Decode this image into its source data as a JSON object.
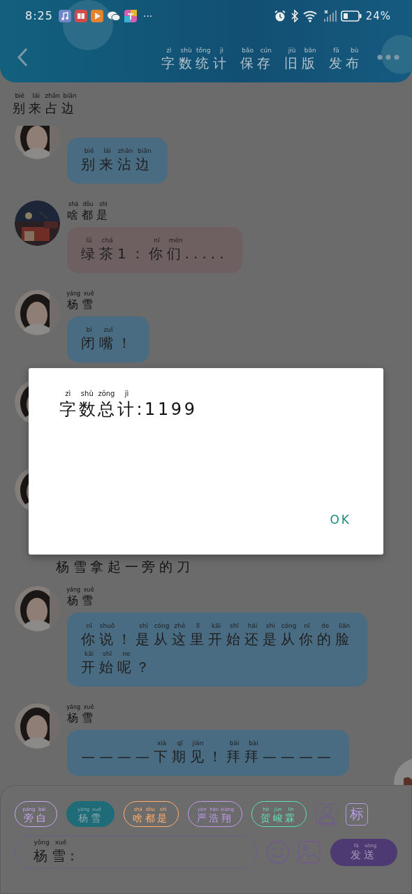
{
  "status_bar": {
    "time": "8:25",
    "more": "···",
    "battery": "24%"
  },
  "header": {
    "actions": [
      {
        "pinyin": "zì shù tǒng jì",
        "text": "字数统计"
      },
      {
        "pinyin": "bǎo cún",
        "text": "保存"
      },
      {
        "pinyin": "jiù bǎn",
        "text": "旧版"
      },
      {
        "pinyin": "fā bù",
        "text": "发布"
      }
    ]
  },
  "title": {
    "pinyin": "bié lái zhān biān",
    "text": "别来占边"
  },
  "messages": [
    {
      "kind": "message",
      "color": "#4a6c82",
      "bubble": {
        "pinyin": "bié lái zhān biān",
        "text": "别来沾边"
      }
    },
    {
      "kind": "message",
      "color": "#6e6060",
      "sender": {
        "pinyin": "shá dōu shì",
        "text": "啥都是"
      },
      "bubble": {
        "pinyin": "lǜ chá nǐ mén",
        "text": "绿茶1：你们....."
      }
    },
    {
      "kind": "message",
      "color": "#4a6c82",
      "sender": {
        "pinyin": "yáng xuě",
        "text": "杨雪"
      },
      "bubble": {
        "pinyin": "bì zuǐ",
        "text": "闭嘴！"
      }
    },
    {
      "kind": "covered"
    },
    {
      "kind": "covered"
    },
    {
      "kind": "narration",
      "text": "杨雪拿起一旁的刀"
    },
    {
      "kind": "message",
      "color": "#4a6c82",
      "sender": {
        "pinyin": "yáng xuě",
        "text": "杨雪"
      },
      "bubble": {
        "pinyin": "nǐ shuō shì cóng zhè lǐ kāi shǐ hái shì cóng nǐ de liǎn",
        "text": "你说！是从这里开始还是从你的脸"
      },
      "bubble_line_2": {
        "pinyin": "kāi shǐ ne",
        "text": "开始呢？"
      }
    },
    {
      "kind": "message",
      "color": "#4a6c82",
      "sender": {
        "pinyin": "yáng xuě",
        "text": "杨雪"
      },
      "bubble": {
        "pinyin": "xià qī jiàn bài bài",
        "text": "————下期见！拜拜————"
      }
    }
  ],
  "roles": [
    {
      "name": {
        "pinyin": "páng bái",
        "text": "旁白"
      },
      "color": "#c8a8f0",
      "selected": false
    },
    {
      "name": {
        "pinyin": "yáng xuě",
        "text": "杨雪"
      },
      "color": "#1f6b78",
      "selected": true
    },
    {
      "name": {
        "pinyin": "shá dōu shì",
        "text": "啥都是"
      },
      "color": "#ffb070",
      "selected": false
    },
    {
      "name": {
        "pinyin": "yán hào xiáng",
        "text": "严浩翔"
      },
      "color": "#c09af0",
      "selected": false
    },
    {
      "name": {
        "pinyin": "hè jùn lín",
        "text": "贺峻霖"
      },
      "color": "#60e0b8",
      "selected": false
    }
  ],
  "mark_button": "标",
  "input": {
    "value": {
      "pinyin": "yǒng xuě",
      "text": "杨雪:"
    }
  },
  "send_button": {
    "pinyin": "fā sòng",
    "text": "发送"
  },
  "dialog": {
    "title": {
      "pinyin": "zì shù zǒng jì",
      "text": "字数总计:1199"
    },
    "button": "OK"
  }
}
